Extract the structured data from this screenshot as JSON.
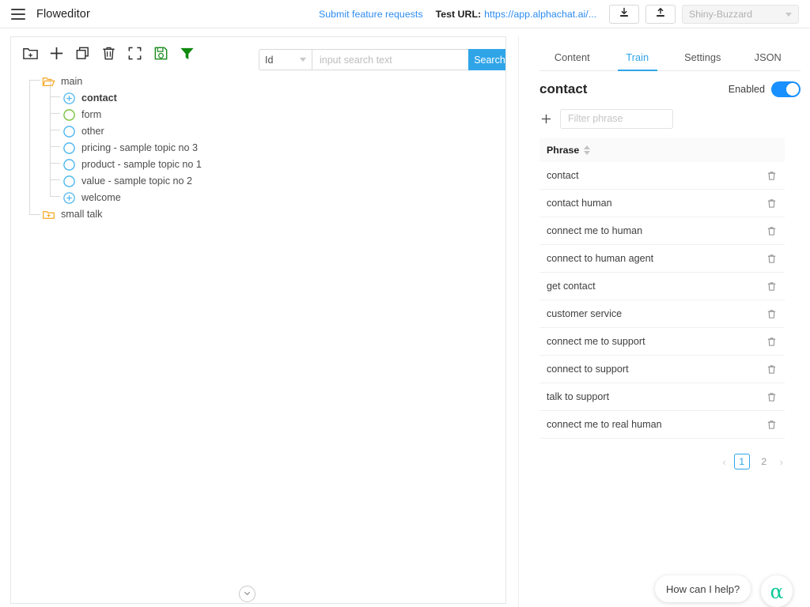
{
  "header": {
    "menu_icon": "hamburger-icon",
    "title": "Floweditor",
    "feature_link": "Submit feature requests",
    "test_url_label": "Test URL:",
    "test_url_value": "https://app.alphachat.ai/...",
    "download_icon": "download-icon",
    "upload_icon": "upload-icon",
    "bot_select_value": "Shiny-Buzzard"
  },
  "left_panel": {
    "toolbar": [
      {
        "name": "add-folder-icon",
        "label": "Add folder"
      },
      {
        "name": "add-icon",
        "label": "Add"
      },
      {
        "name": "copy-icon",
        "label": "Copy"
      },
      {
        "name": "delete-icon",
        "label": "Delete"
      },
      {
        "name": "fullscreen-icon",
        "label": "Fullscreen"
      },
      {
        "name": "save-icon",
        "label": "Save"
      },
      {
        "name": "filter-icon",
        "label": "Filter"
      }
    ],
    "search": {
      "field_value": "Id",
      "placeholder": "input search text",
      "input_value": "",
      "button_label": "Search"
    },
    "tree": [
      {
        "label": "main",
        "type": "folder-open",
        "depth": 0,
        "bold": false
      },
      {
        "label": "contact",
        "type": "node-plus",
        "depth": 1,
        "bold": true
      },
      {
        "label": "form",
        "type": "node-green",
        "depth": 1,
        "bold": false
      },
      {
        "label": "other",
        "type": "node-blue",
        "depth": 1,
        "bold": false
      },
      {
        "label": "pricing - sample topic no 3",
        "type": "node-blue",
        "depth": 1,
        "bold": false
      },
      {
        "label": "product - sample topic no 1",
        "type": "node-blue",
        "depth": 1,
        "bold": false
      },
      {
        "label": "value - sample topic no 2",
        "type": "node-blue",
        "depth": 1,
        "bold": false
      },
      {
        "label": "welcome",
        "type": "node-plus",
        "depth": 1,
        "bold": false
      },
      {
        "label": "small talk",
        "type": "folder-closed",
        "depth": 0,
        "bold": false
      }
    ],
    "collapse_icon": "chevron-down-icon"
  },
  "right_panel": {
    "tabs": [
      {
        "label": "Content",
        "active": false
      },
      {
        "label": "Train",
        "active": true
      },
      {
        "label": "Settings",
        "active": false
      },
      {
        "label": "JSON",
        "active": false
      }
    ],
    "topic_title": "contact",
    "enabled_label": "Enabled",
    "enabled_state": true,
    "add_phrase_icon": "plus-icon",
    "filter_placeholder": "Filter phrase",
    "filter_value": "",
    "table": {
      "column_header": "Phrase",
      "rows": [
        "contact",
        "contact human",
        "connect me to human",
        "connect to human agent",
        "get contact",
        "customer service",
        "connect me to support",
        "connect to support",
        "talk to support",
        "connect me to real human"
      ],
      "row_delete_icon": "trash-icon"
    },
    "pagination": {
      "prev_icon": "chevron-left-icon",
      "next_icon": "chevron-right-icon",
      "pages": [
        "1",
        "2"
      ],
      "current": "1"
    }
  },
  "chat_widget": {
    "bubble_text": "How can I help?",
    "launcher_icon": "alpha-logo-icon",
    "launcher_glyph": "α"
  },
  "colors": {
    "accent_blue": "#2fa5e8",
    "toggle_blue": "#1890ff",
    "link_blue": "#2d8cf0",
    "folder_orange": "#f5a623",
    "node_blue": "#4fb8ef",
    "node_green": "#7cc142",
    "save_green": "#1a8a1a",
    "filter_green": "#0f8a0f",
    "chat_teal": "#0ec99a"
  }
}
